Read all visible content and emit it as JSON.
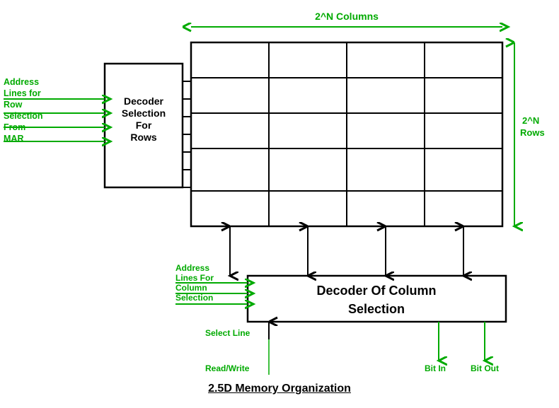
{
  "title": "2.5D Memory Organization",
  "labels": {
    "address_lines_row": "Address\nLines for\nRow\nSelection\nFrom\nMAR",
    "decoder_rows": "Decoder\nSelection\nFor\nRows",
    "columns_label": "2^N Columns",
    "rows_label": "2^N\nRows",
    "address_lines_col": "Address\nLines For\nColumn\nSelection",
    "decoder_col": "Decoder Of Column Selection",
    "select_line": "Select Line",
    "read_write": "Read/Write",
    "bit_in": "Bit In",
    "bit_out": "Bit Out"
  },
  "colors": {
    "green": "#00aa00",
    "black": "#000000",
    "box_border": "#000000"
  }
}
